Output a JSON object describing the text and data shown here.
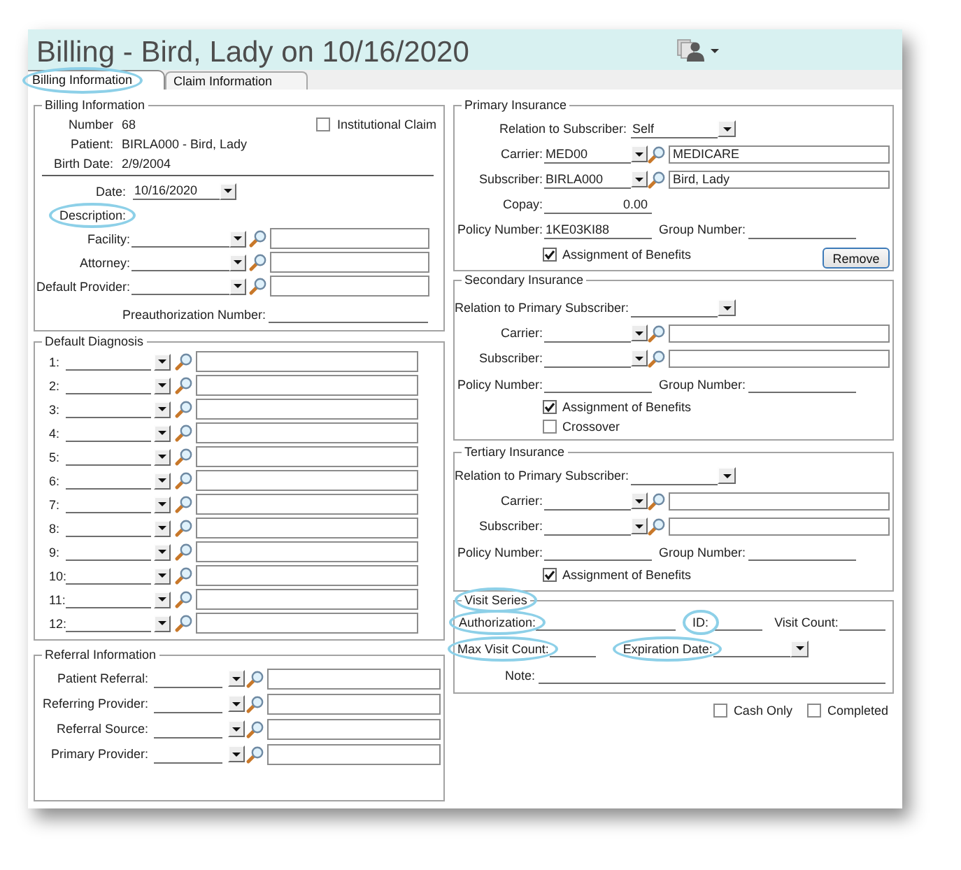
{
  "window": {
    "title": "Billing - Bird, Lady on 10/16/2020"
  },
  "tabs": [
    {
      "label": "Billing Information",
      "selected": true,
      "highlighted": true
    },
    {
      "label": "Claim Information",
      "selected": false,
      "highlighted": false
    }
  ],
  "billing_information": {
    "title": "Billing Information",
    "details": [
      {
        "label": "Number",
        "value": "68"
      },
      {
        "label": "Patient:",
        "value": "BIRLA000 - Bird, Lady"
      },
      {
        "label": "Birth Date:",
        "value": "2/9/2004"
      }
    ],
    "institutional_claim": {
      "label": "Institutional Claim",
      "checked": false
    },
    "date": {
      "label": "Date:",
      "value": "10/16/2020"
    },
    "description": {
      "label": "Description:",
      "highlighted": true
    },
    "lookups": [
      {
        "label": "Facility:"
      },
      {
        "label": "Attorney:"
      },
      {
        "label": "Default Provider:"
      }
    ],
    "preauthorization": {
      "label": "Preauthorization Number:"
    }
  },
  "default_diagnosis": {
    "title": "Default Diagnosis",
    "rows": [
      {
        "label": "1:"
      },
      {
        "label": "2:"
      },
      {
        "label": "3:"
      },
      {
        "label": "4:"
      },
      {
        "label": "5:"
      },
      {
        "label": "6:"
      },
      {
        "label": "7:"
      },
      {
        "label": "8:"
      },
      {
        "label": "9:"
      },
      {
        "label": "10:"
      },
      {
        "label": "11:"
      },
      {
        "label": "12:"
      }
    ]
  },
  "referral_information": {
    "title": "Referral Information",
    "rows": [
      {
        "label": "Patient Referral:"
      },
      {
        "label": "Referring Provider:"
      },
      {
        "label": "Referral Source:"
      },
      {
        "label": "Primary Provider:"
      }
    ]
  },
  "insurances": [
    {
      "title": "Primary Insurance",
      "relation": {
        "label": "Relation to Subscriber:",
        "value": "Self"
      },
      "carrier": {
        "label": "Carrier:",
        "code": "MED00",
        "name": "MEDICARE"
      },
      "subscriber": {
        "label": "Subscriber:",
        "code": "BIRLA000",
        "name": "Bird, Lady"
      },
      "copay": {
        "label": "Copay:",
        "value": "0.00"
      },
      "policy_number": {
        "label": "Policy Number:",
        "value": "1KE03KI88"
      },
      "group_number": {
        "label": "Group Number:"
      },
      "options": [
        {
          "label": "Assignment of Benefits",
          "checked": true
        }
      ],
      "remove_button": "Remove"
    },
    {
      "title": "Secondary Insurance",
      "relation": {
        "label": "Relation to Primary Subscriber:"
      },
      "carrier": {
        "label": "Carrier:"
      },
      "subscriber": {
        "label": "Subscriber:"
      },
      "policy_number": {
        "label": "Policy Number:"
      },
      "group_number": {
        "label": "Group Number:"
      },
      "options": [
        {
          "label": "Assignment of Benefits",
          "checked": true
        },
        {
          "label": "Crossover",
          "checked": false
        }
      ]
    },
    {
      "title": "Tertiary Insurance",
      "relation": {
        "label": "Relation to Primary Subscriber:"
      },
      "carrier": {
        "label": "Carrier:"
      },
      "subscriber": {
        "label": "Subscriber:"
      },
      "policy_number": {
        "label": "Policy Number:"
      },
      "group_number": {
        "label": "Group Number:"
      },
      "options": [
        {
          "label": "Assignment of Benefits",
          "checked": true
        }
      ]
    }
  ],
  "visit_series": {
    "title": "Visit Series",
    "highlighted": true,
    "rows": [
      {
        "fields": [
          {
            "label": "Authorization:",
            "kind": "text",
            "highlighted": true
          },
          {
            "label": "ID:",
            "kind": "text",
            "highlighted": true
          },
          {
            "label": "Visit Count:",
            "kind": "text",
            "highlighted": false
          }
        ]
      },
      {
        "fields": [
          {
            "label": "Max Visit Count:",
            "kind": "text",
            "highlighted": true
          },
          {
            "label": "Expiration Date:",
            "kind": "dropdown",
            "highlighted": true
          }
        ]
      },
      {
        "fields": [
          {
            "label": "Note:",
            "kind": "text",
            "highlighted": false
          }
        ]
      }
    ]
  },
  "footer_options": [
    {
      "label": "Cash Only",
      "checked": false
    },
    {
      "label": "Completed",
      "checked": false
    }
  ]
}
